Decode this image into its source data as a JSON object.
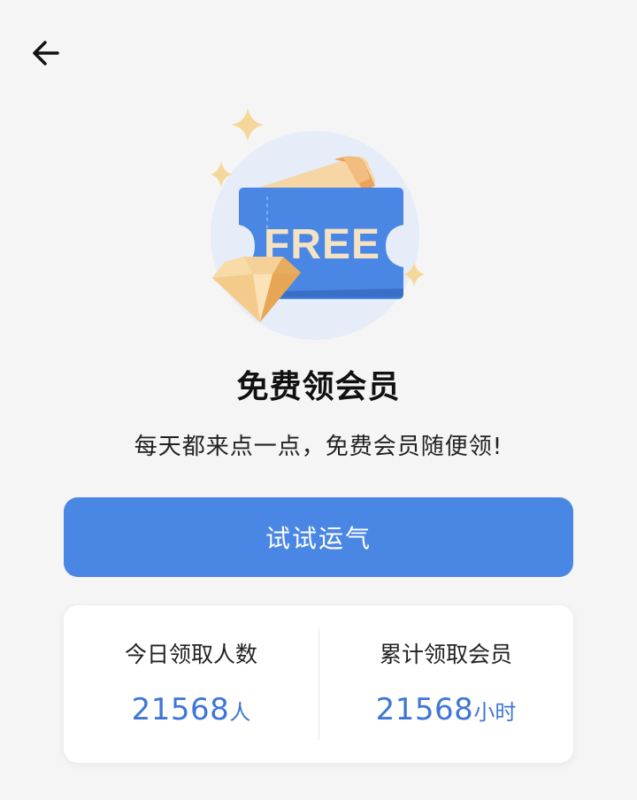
{
  "header": {
    "back_icon": "arrow-left-icon"
  },
  "hero": {
    "ticket_text": "FREE",
    "colors": {
      "ticket_blue": "#4a86e3",
      "gold": "#f4c27a",
      "circle": "#e6edf8"
    }
  },
  "main": {
    "title": "免费领会员",
    "subtitle": "每天都来点一点，免费会员随便领!",
    "try_button_label": "试试运气"
  },
  "stats": {
    "today": {
      "label": "今日领取人数",
      "value": "21568",
      "unit": "人"
    },
    "total": {
      "label": "累计领取会员",
      "value": "21568",
      "unit": "小时"
    }
  },
  "colors": {
    "accent": "#4a86e3",
    "stat_value": "#3f76d6",
    "background": "#f5f5f5"
  }
}
